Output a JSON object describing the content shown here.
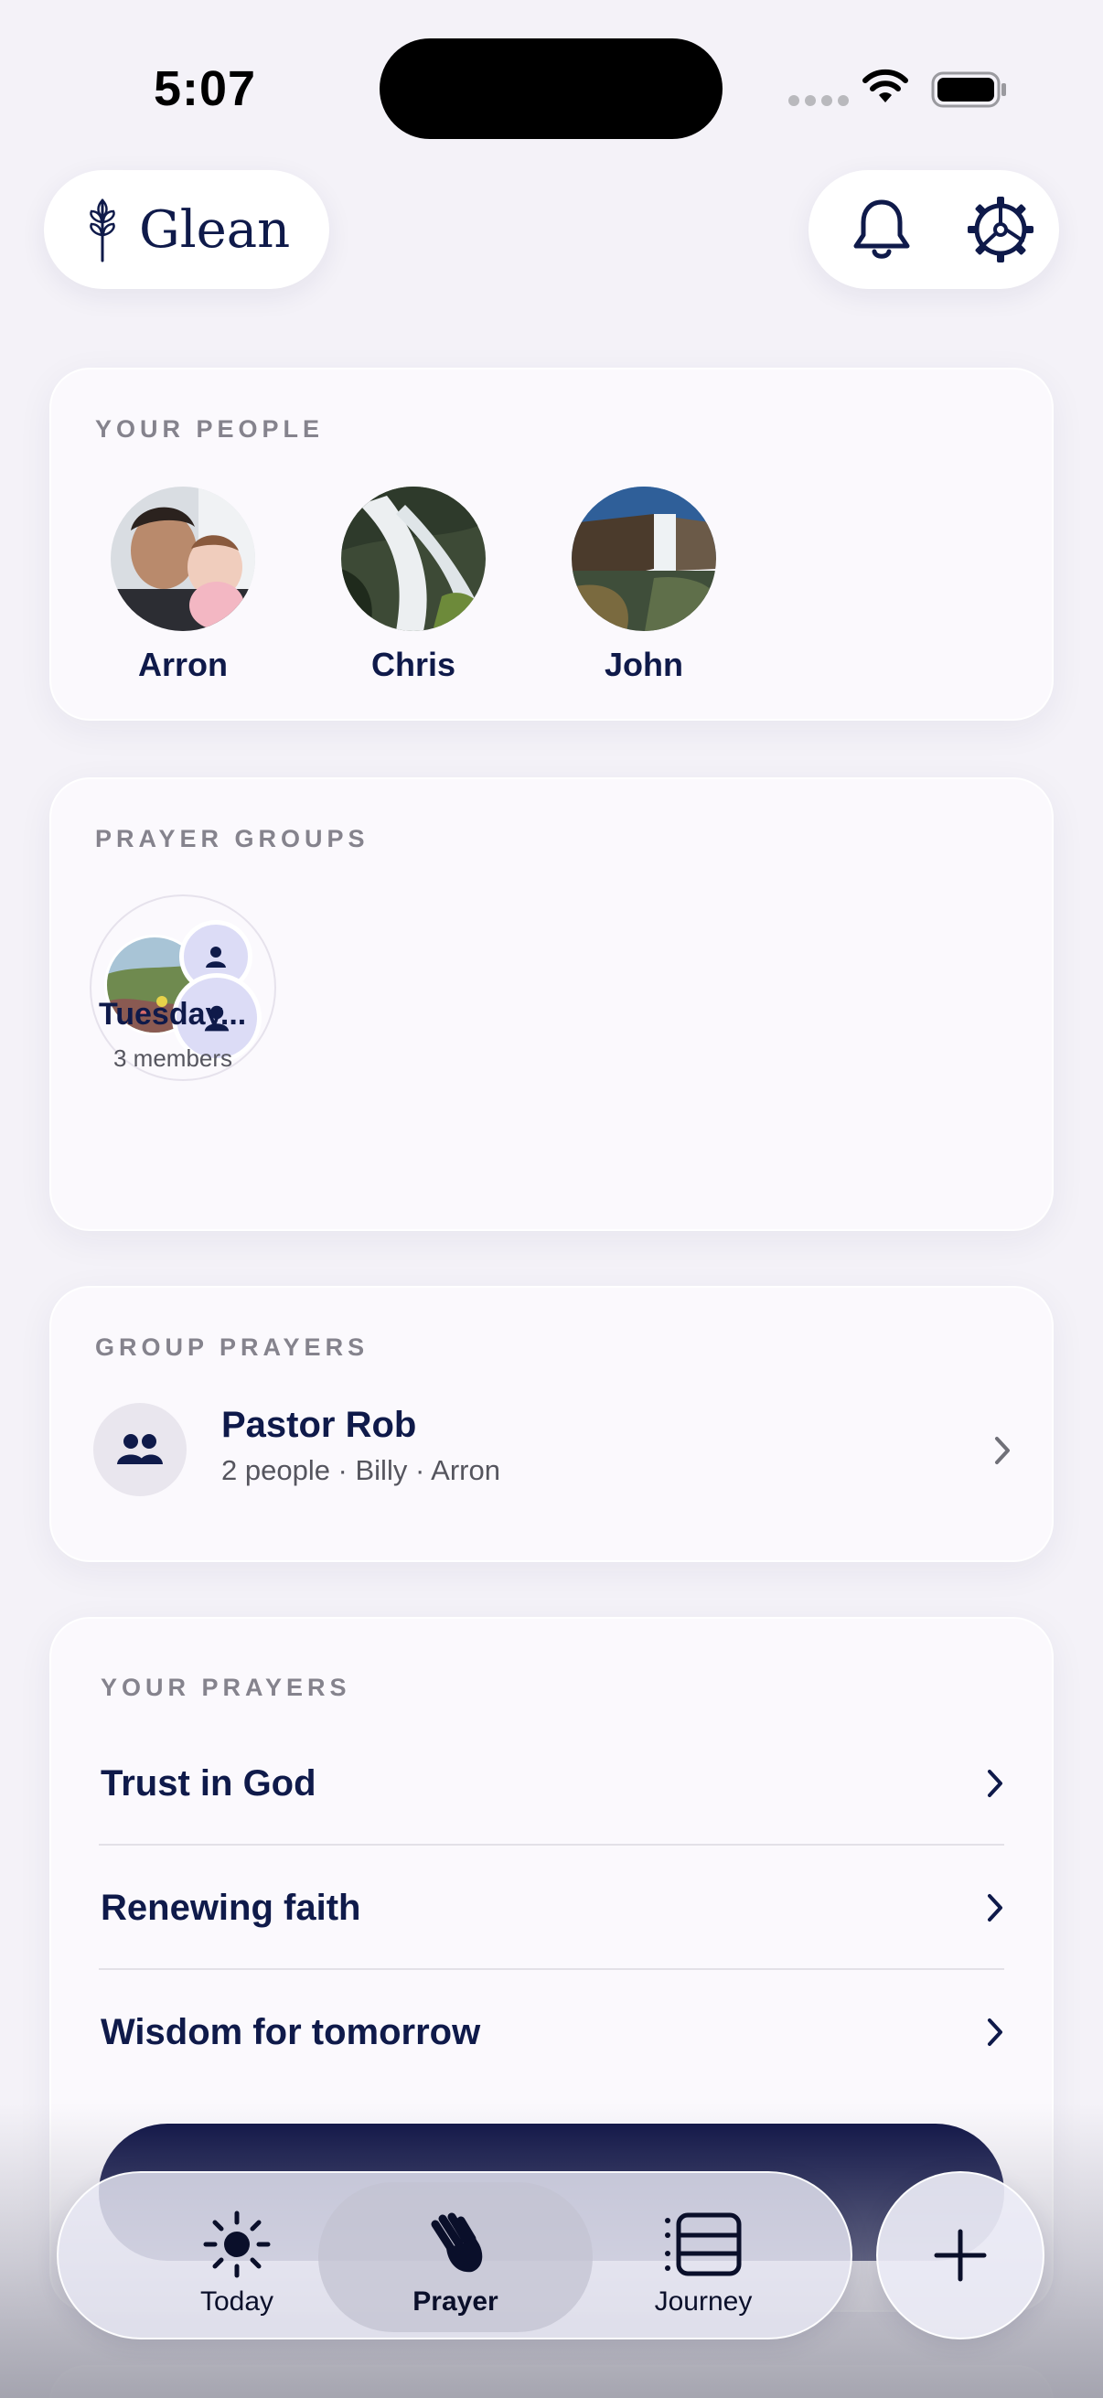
{
  "status_bar": {
    "time": "5:07"
  },
  "header": {
    "brand": "Glean",
    "icons": {
      "brand": "wheat-icon",
      "notifications": "bell-icon",
      "settings": "gear-icon"
    }
  },
  "your_people": {
    "title": "YOUR PEOPLE",
    "people": [
      {
        "name": "Arron"
      },
      {
        "name": "Chris"
      },
      {
        "name": "John"
      }
    ]
  },
  "prayer_groups": {
    "title": "PRAYER GROUPS",
    "groups": [
      {
        "name": "Tuesday...",
        "members": "3 members"
      }
    ]
  },
  "group_prayers": {
    "title": "GROUP PRAYERS",
    "items": [
      {
        "title": "Pastor Rob",
        "subtitle": "2 people · Billy · Arron",
        "icon": "people-icon"
      }
    ]
  },
  "your_prayers": {
    "title": "YOUR PRAYERS",
    "items": [
      {
        "label": "Trust in God"
      },
      {
        "label": "Renewing faith"
      },
      {
        "label": "Wisdom for tomorrow"
      }
    ]
  },
  "tab_bar": {
    "tabs": [
      {
        "label": "Today",
        "icon": "sun-icon",
        "active": false
      },
      {
        "label": "Prayer",
        "icon": "praying-hands-icon",
        "active": true
      },
      {
        "label": "Journey",
        "icon": "list-icon",
        "active": false
      }
    ],
    "fab_icon": "plus-icon"
  },
  "colors": {
    "navy": "#0f1a4a",
    "cta": "#0a0f42",
    "background": "#f4f2f8"
  }
}
